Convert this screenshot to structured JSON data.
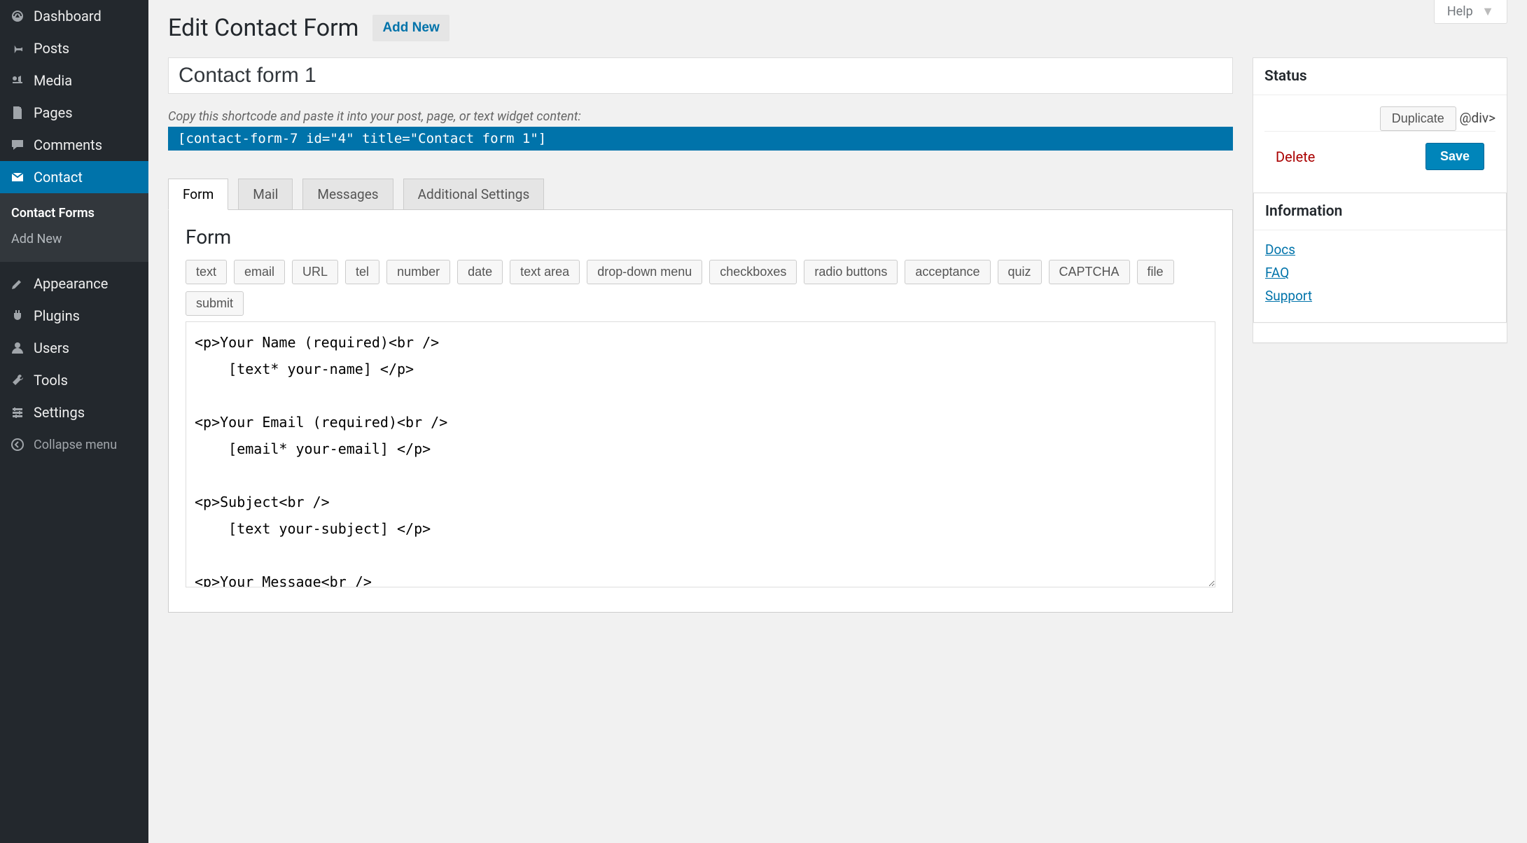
{
  "help": {
    "label": "Help"
  },
  "sidebar": {
    "items": [
      {
        "label": "Dashboard"
      },
      {
        "label": "Posts"
      },
      {
        "label": "Media"
      },
      {
        "label": "Pages"
      },
      {
        "label": "Comments"
      },
      {
        "label": "Contact"
      },
      {
        "label": "Appearance"
      },
      {
        "label": "Plugins"
      },
      {
        "label": "Users"
      },
      {
        "label": "Tools"
      },
      {
        "label": "Settings"
      }
    ],
    "sub": {
      "contact_forms": "Contact Forms",
      "add_new": "Add New"
    },
    "collapse": "Collapse menu"
  },
  "heading": {
    "title": "Edit Contact Form",
    "add_new": "Add New"
  },
  "form_title": "Contact form 1",
  "shortcode_hint": "Copy this shortcode and paste it into your post, page, or text widget content:",
  "shortcode": "[contact-form-7 id=\"4\" title=\"Contact form 1\"]",
  "tabs": {
    "form": "Form",
    "mail": "Mail",
    "messages": "Messages",
    "additional": "Additional Settings"
  },
  "panel": {
    "heading": "Form",
    "tags": [
      "text",
      "email",
      "URL",
      "tel",
      "number",
      "date",
      "text area",
      "drop-down menu",
      "checkboxes",
      "radio buttons",
      "acceptance",
      "quiz",
      "CAPTCHA",
      "file",
      "submit"
    ],
    "content": "<p>Your Name (required)<br />\n    [text* your-name] </p>\n\n<p>Your Email (required)<br />\n    [email* your-email] </p>\n\n<p>Subject<br />\n    [text your-subject] </p>\n\n<p>Your Message<br />\n    [textarea your-message] </p>\n\n<p>[submit \"Send\"]</p>"
  },
  "status": {
    "heading": "Status",
    "duplicate": "Duplicate",
    "delete": "Delete",
    "save": "Save"
  },
  "info": {
    "heading": "Information",
    "docs": "Docs",
    "faq": "FAQ",
    "support": "Support"
  }
}
